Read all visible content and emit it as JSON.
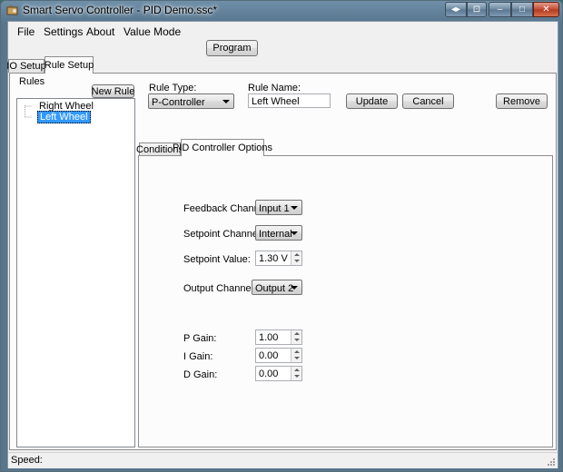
{
  "window": {
    "title": "Smart Servo Controller - PID Demo.ssc*"
  },
  "caption_buttons": {
    "extra": "◂▸",
    "help": "⊡",
    "minimize": "–",
    "maximize": "□",
    "close": "✕"
  },
  "menu": [
    "File",
    "Settings",
    "About",
    "Value Mode"
  ],
  "toolbar": {
    "program_label": "Program"
  },
  "main_tabs": [
    "IO Setup",
    "Rule Setup"
  ],
  "rules": {
    "group_label": "Rules",
    "new_rule_label": "New Rule",
    "items": [
      "Right Wheel",
      "Left Wheel"
    ],
    "selected_index": 1
  },
  "rule_editor": {
    "rule_type_label": "Rule Type:",
    "rule_type_value": "P-Controller",
    "rule_name_label": "Rule Name:",
    "rule_name_value": "Left Wheel",
    "update_label": "Update",
    "cancel_label": "Cancel",
    "remove_label": "Remove"
  },
  "sub_tabs": [
    "Conditions",
    "PID Controller Options"
  ],
  "pid": {
    "feedback_label": "Feedback Channel:",
    "feedback_value": "Input 1",
    "setpoint_channel_label": "Setpoint Channel:",
    "setpoint_channel_value": "Internal",
    "setpoint_value_label": "Setpoint Value:",
    "setpoint_value": "1.30 V",
    "output_label": "Output Channel:",
    "output_value": "Output 2",
    "p_label": "P Gain:",
    "p_value": "1.00",
    "i_label": "I Gain:",
    "i_value": "0.00",
    "d_label": "D Gain:",
    "d_value": "0.00"
  },
  "status": {
    "speed_label": "Speed:"
  }
}
